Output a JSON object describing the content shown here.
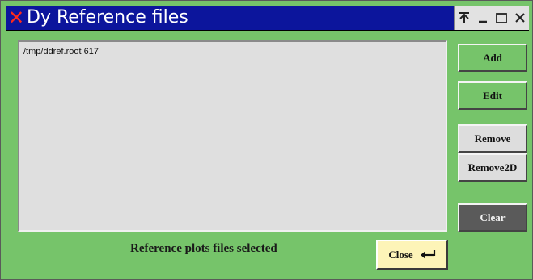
{
  "window": {
    "title": "Dy Reference files"
  },
  "titlebar_controls": {
    "pin_glyph": "⍒",
    "minimize_glyph": "_",
    "maximize_glyph": "□",
    "close_glyph": "✕"
  },
  "app_icon_glyph": "✕",
  "list": {
    "items": [
      "/tmp/ddref.root  617"
    ]
  },
  "buttons": {
    "add": "Add",
    "edit": "Edit",
    "remove": "Remove",
    "remove2d": "Remove2D",
    "clear": "Clear",
    "close": "Close"
  },
  "status_text": "Reference plots files selected",
  "colors": {
    "window_bg": "#76c46a",
    "titlebar": "#0c159c",
    "close_button": "#fdf4b8",
    "clear_button": "#5a5a5a",
    "app_icon": "#ff2a1a"
  },
  "icons": {
    "close_button_icon": "return-arrow-icon"
  }
}
